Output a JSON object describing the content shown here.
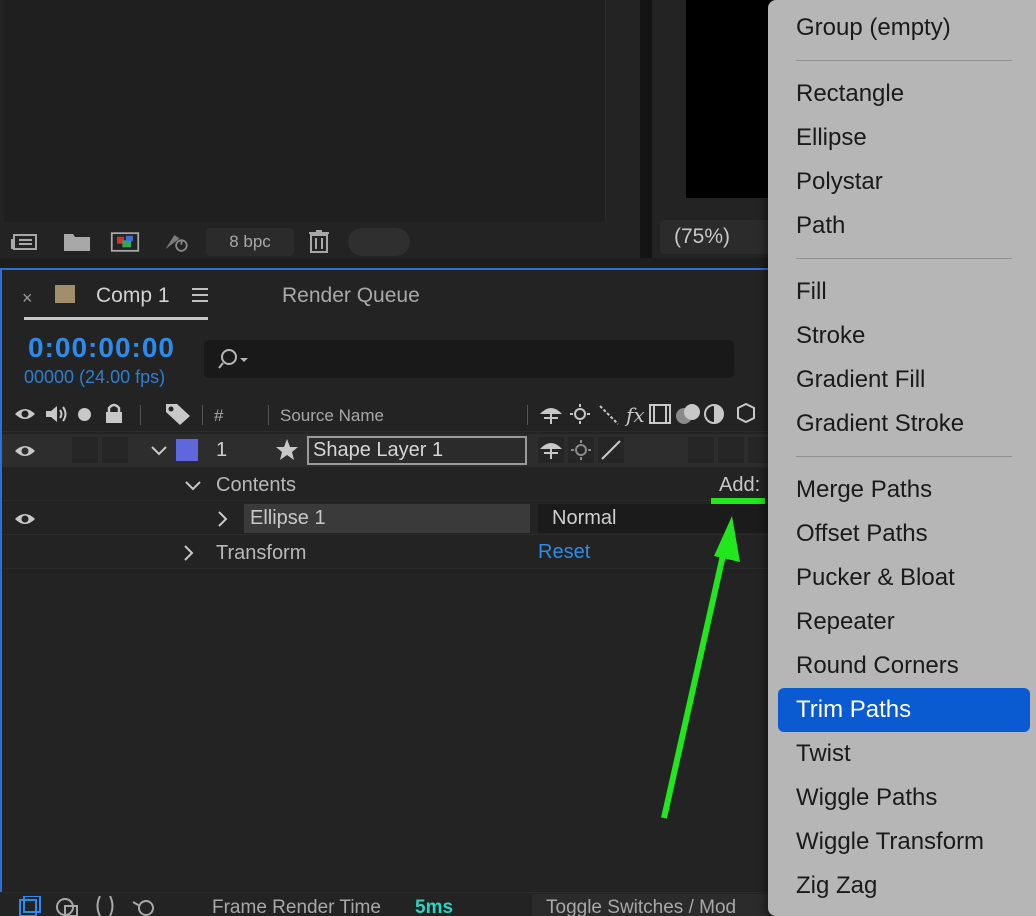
{
  "project_panel": {
    "bpc": "8 bpc"
  },
  "viewer": {
    "zoom": "(75%)"
  },
  "timeline": {
    "tabs": [
      {
        "close": "×",
        "label": "Comp 1"
      },
      {
        "label": "Render Queue"
      }
    ],
    "timecode": "0:00:00:00",
    "frame_info": "00000 (24.00 fps)",
    "columns": {
      "number": "#",
      "source_name": "Source Name"
    },
    "layer": {
      "number": "1",
      "name": "Shape Layer 1"
    },
    "contents_label": "Contents",
    "add_label": "Add:",
    "ellipse_label": "Ellipse 1",
    "blend_mode": "Normal",
    "transform_label": "Transform",
    "reset_label": "Reset",
    "bottom": {
      "frame_render_label": "Frame Render Time",
      "frame_render_value": "5ms",
      "toggle_label": "Toggle Switches / Mod"
    }
  },
  "menu": {
    "items": [
      "Group (empty)",
      "Rectangle",
      "Ellipse",
      "Polystar",
      "Path",
      "Fill",
      "Stroke",
      "Gradient Fill",
      "Gradient Stroke",
      "Merge Paths",
      "Offset Paths",
      "Pucker & Bloat",
      "Repeater",
      "Round Corners",
      "Trim Paths",
      "Twist",
      "Wiggle Paths",
      "Wiggle Transform",
      "Zig Zag"
    ],
    "highlighted": "Trim Paths"
  },
  "colors": {
    "accent_blue": "#2d8ceb",
    "menu_highlight": "#0a5bd1",
    "annotation_green": "#22e61e",
    "layer_label": "#6066db"
  },
  "icons": [
    "flowchart-icon",
    "folder-icon",
    "composition-icon",
    "render-icon",
    "trash-icon",
    "search-icon",
    "eye-icon",
    "audio-icon",
    "solo-icon",
    "lock-icon",
    "label-icon",
    "star-icon",
    "chevron-icon"
  ]
}
